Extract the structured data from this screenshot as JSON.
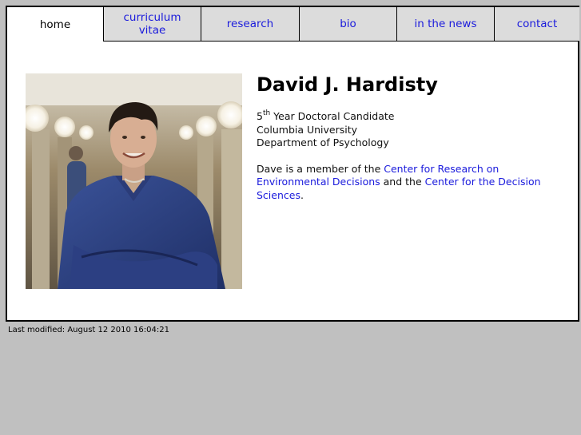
{
  "nav": {
    "tabs": [
      {
        "label": "home",
        "active": true
      },
      {
        "label": "curriculum vitae",
        "active": false
      },
      {
        "label": "research",
        "active": false
      },
      {
        "label": "bio",
        "active": false
      },
      {
        "label": "in the news",
        "active": false
      },
      {
        "label": "contact",
        "active": false
      }
    ]
  },
  "profile": {
    "name": "David J. Hardisty",
    "year_number": "5",
    "year_suffix": "th",
    "title_rest": " Year Doctoral Candidate",
    "university": "Columbia University",
    "department": "Department of Psychology",
    "photo_icon": "portrait-photo"
  },
  "about": {
    "prefix": "Dave is a member of the ",
    "link1": "Center for Research on Environmental Decisions",
    "middle": " and the ",
    "link2": "Center for the Decision Sciences",
    "suffix": "."
  },
  "footer": {
    "last_modified": "Last modified: August 12 2010 16:04:21"
  },
  "colors": {
    "link": "#1a1adc",
    "tab_bg": "#dcdcdc",
    "page_bg": "#c0c0c0"
  }
}
